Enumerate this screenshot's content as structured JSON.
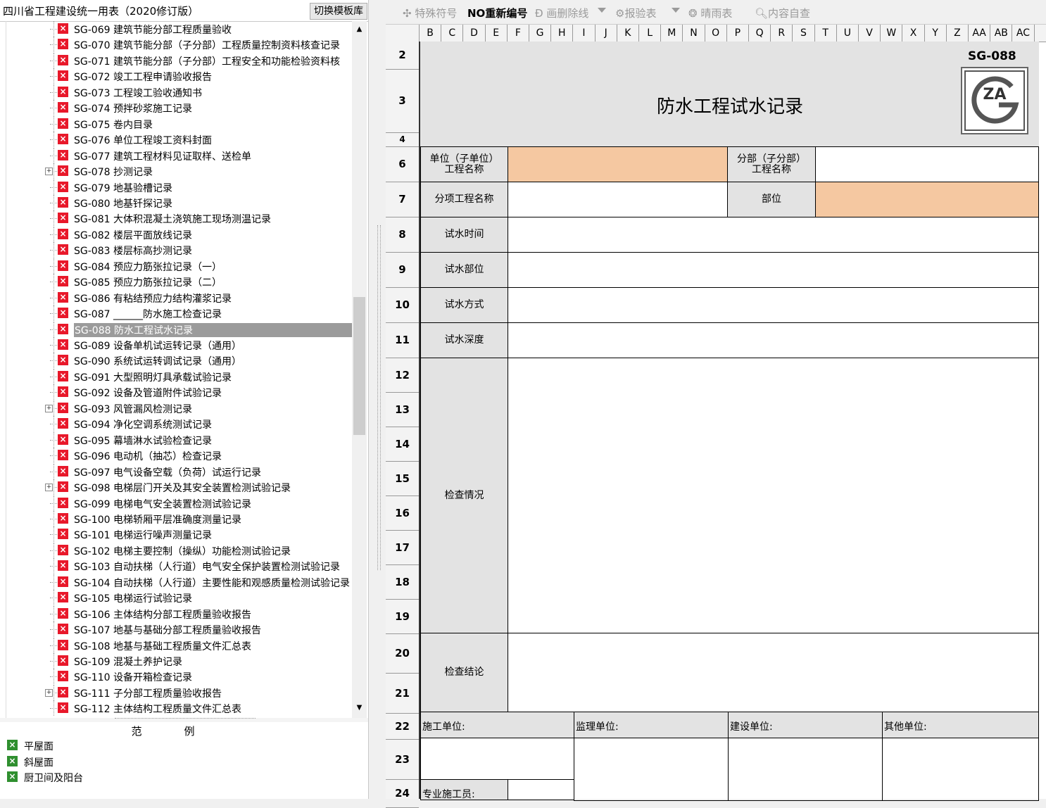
{
  "left_panel": {
    "title": "四川省工程建设统一用表（2020修订版）",
    "switch_button": "切换模板库",
    "tree_items": [
      {
        "label": "SG-069 建筑节能分部工程质量验收"
      },
      {
        "label": "SG-070 建筑节能分部（子分部）工程质量控制资料核查记录"
      },
      {
        "label": "SG-071 建筑节能分部（子分部）工程安全和功能检验资料核"
      },
      {
        "label": "SG-072 竣工工程申请验收报告"
      },
      {
        "label": "SG-073 工程竣工验收通知书"
      },
      {
        "label": "SG-074 预拌砂浆施工记录"
      },
      {
        "label": "SG-075 卷内目录"
      },
      {
        "label": "SG-076 单位工程竣工资料封面"
      },
      {
        "label": "SG-077 建筑工程材料见证取样、送检单"
      },
      {
        "label": "SG-078 抄测记录",
        "expandable": true
      },
      {
        "label": "SG-079 地基验槽记录"
      },
      {
        "label": "SG-080 地基钎探记录"
      },
      {
        "label": "SG-081 大体积混凝土浇筑施工现场测温记录"
      },
      {
        "label": "SG-082 楼层平面放线记录"
      },
      {
        "label": "SG-083 楼层标高抄测记录"
      },
      {
        "label": "SG-084 预应力筋张拉记录（一）"
      },
      {
        "label": "SG-085 预应力筋张拉记录（二）"
      },
      {
        "label": "SG-086 有粘结预应力结构灌浆记录"
      },
      {
        "label": "SG-087 ______防水施工检查记录"
      },
      {
        "label": "SG-088 防水工程试水记录",
        "selected": true
      },
      {
        "label": "SG-089 设备单机试运转记录（通用）"
      },
      {
        "label": "SG-090 系统试运转调试记录（通用）"
      },
      {
        "label": "SG-091 大型照明灯具承载试验记录"
      },
      {
        "label": "SG-092 设备及管道附件试验记录"
      },
      {
        "label": "SG-093 风管漏风检测记录",
        "expandable": true
      },
      {
        "label": "SG-094 净化空调系统测试记录"
      },
      {
        "label": "SG-095 幕墙淋水试验检查记录"
      },
      {
        "label": "SG-096 电动机（抽芯）检查记录"
      },
      {
        "label": "SG-097 电气设备空载（负荷）试运行记录"
      },
      {
        "label": "SG-098 电梯层门开关及其安全装置检测试验记录",
        "expandable": true
      },
      {
        "label": "SG-099 电梯电气安全装置检测试验记录"
      },
      {
        "label": "SG-100 电梯轿厢平层准确度测量记录"
      },
      {
        "label": "SG-101 电梯运行噪声测量记录"
      },
      {
        "label": "SG-102 电梯主要控制（操纵）功能检测试验记录"
      },
      {
        "label": "SG-103 自动扶梯（人行道）电气安全保护装置检测试验记录"
      },
      {
        "label": "SG-104 自动扶梯（人行道）主要性能和观感质量检测试验记录"
      },
      {
        "label": "SG-105 电梯运行试验记录"
      },
      {
        "label": "SG-106 主体结构分部工程质量验收报告"
      },
      {
        "label": "SG-107 地基与基础分部工程质量验收报告"
      },
      {
        "label": "SG-108 地基与基础工程质量文件汇总表"
      },
      {
        "label": "SG-109 混凝土养护记录"
      },
      {
        "label": "SG-110 设备开箱检查记录"
      },
      {
        "label": "SG-111 子分部工程质量验收报告",
        "expandable": true
      },
      {
        "label": "SG-112 主体结构工程质量文件汇总表"
      }
    ],
    "legend_title": "范例",
    "legend_items": [
      "平屋面",
      "斜屋面",
      "厨卫间及阳台"
    ]
  },
  "toolbar": {
    "special_symbol": "特殊符号",
    "renumber": "重新编号",
    "strikethrough": "画删除线",
    "inspection": "报验表",
    "weather": "晴雨表",
    "self_check": "内容自查",
    "no_mark": "NO"
  },
  "columns": [
    "B",
    "C",
    "D",
    "E",
    "F",
    "G",
    "H",
    "I",
    "J",
    "K",
    "L",
    "M",
    "N",
    "O",
    "P",
    "Q",
    "R",
    "S",
    "T",
    "U",
    "V",
    "W",
    "X",
    "Y",
    "Z",
    "AA",
    "AB",
    "AC"
  ],
  "rows": [
    "2",
    "3",
    "4",
    "6",
    "7",
    "8",
    "9",
    "10",
    "11",
    "12",
    "13",
    "14",
    "15",
    "16",
    "17",
    "18",
    "19",
    "20",
    "21",
    "22",
    "23",
    "24"
  ],
  "form": {
    "code": "SG-088",
    "title": "防水工程试水记录",
    "unit_label": "单位（子单位）\n工程名称",
    "subdivision_label": "分部（子分部）\n工程名称",
    "item_label": "分项工程名称",
    "location_label": "部位",
    "test_time_label": "试水时间",
    "test_area_label": "试水部位",
    "test_method_label": "试水方式",
    "test_depth_label": "试水深度",
    "inspection_label": "检查情况",
    "conclusion_label": "检查结论",
    "construction_unit": "施工单位:",
    "supervision_unit": "监理单位:",
    "owner_unit": "建设单位:",
    "other_unit": "其他单位:",
    "specialist": "专业施工员:",
    "logo_text": "ZA"
  }
}
